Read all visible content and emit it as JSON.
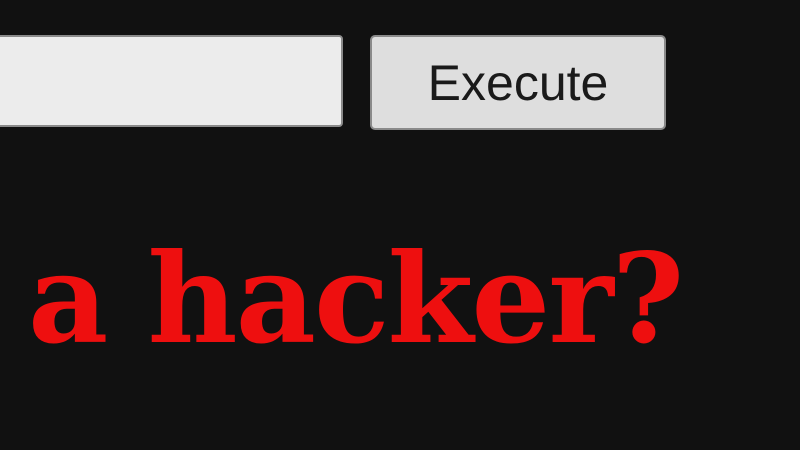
{
  "command": {
    "input_value": "",
    "execute_label": "Execute"
  },
  "headline": {
    "text": "a hacker?",
    "color": "#ee0f0f"
  }
}
